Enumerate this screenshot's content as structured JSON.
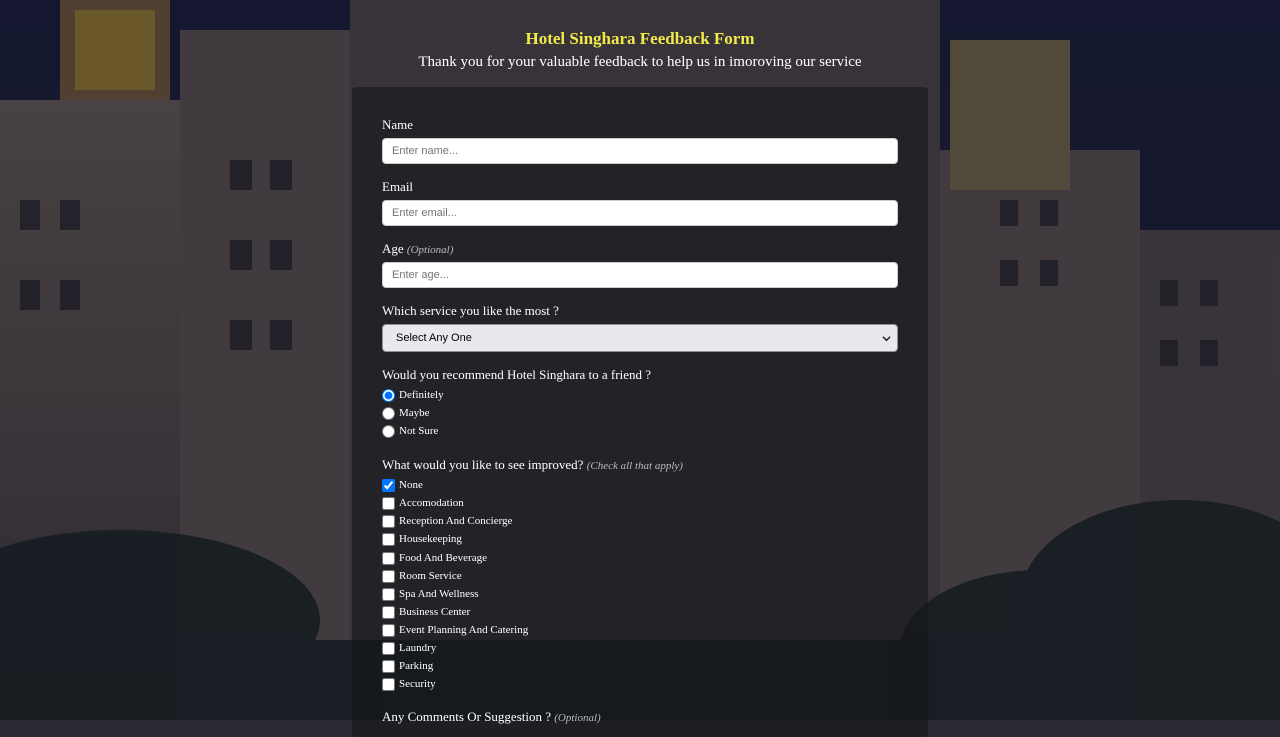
{
  "header": {
    "title": "Hotel Singhara Feedback Form",
    "subtitle": "Thank you for your valuable feedback to help us in imoroving our service"
  },
  "form": {
    "name": {
      "label": "Name",
      "placeholder": "Enter name...",
      "value": ""
    },
    "email": {
      "label": "Email",
      "placeholder": "Enter email...",
      "value": ""
    },
    "age": {
      "label": "Age",
      "optional": "(Optional)",
      "placeholder": "Enter age...",
      "value": ""
    },
    "service": {
      "label": "Which service you like the most ?",
      "selected": "Select Any One"
    },
    "recommend": {
      "label": "Would you recommend Hotel Singhara to a friend ?",
      "options": [
        {
          "label": "Definitely",
          "checked": true
        },
        {
          "label": "Maybe",
          "checked": false
        },
        {
          "label": "Not Sure",
          "checked": false
        }
      ]
    },
    "improve": {
      "label": "What would you like to see improved?",
      "hint": "(Check all that apply)",
      "options": [
        {
          "label": "None",
          "checked": true
        },
        {
          "label": "Accomodation",
          "checked": false
        },
        {
          "label": "Reception And Concierge",
          "checked": false
        },
        {
          "label": "Housekeeping",
          "checked": false
        },
        {
          "label": "Food And Beverage",
          "checked": false
        },
        {
          "label": "Room Service",
          "checked": false
        },
        {
          "label": "Spa And Wellness",
          "checked": false
        },
        {
          "label": "Business Center",
          "checked": false
        },
        {
          "label": "Event Planning And Catering",
          "checked": false
        },
        {
          "label": "Laundry",
          "checked": false
        },
        {
          "label": "Parking",
          "checked": false
        },
        {
          "label": "Security",
          "checked": false
        }
      ]
    },
    "comments": {
      "label": "Any Comments Or Suggestion ?",
      "optional": "(Optional)"
    }
  },
  "colors": {
    "title": "#f2e94a",
    "panel": "rgba(20,20,25,0.55)",
    "accent": "#0060df"
  }
}
